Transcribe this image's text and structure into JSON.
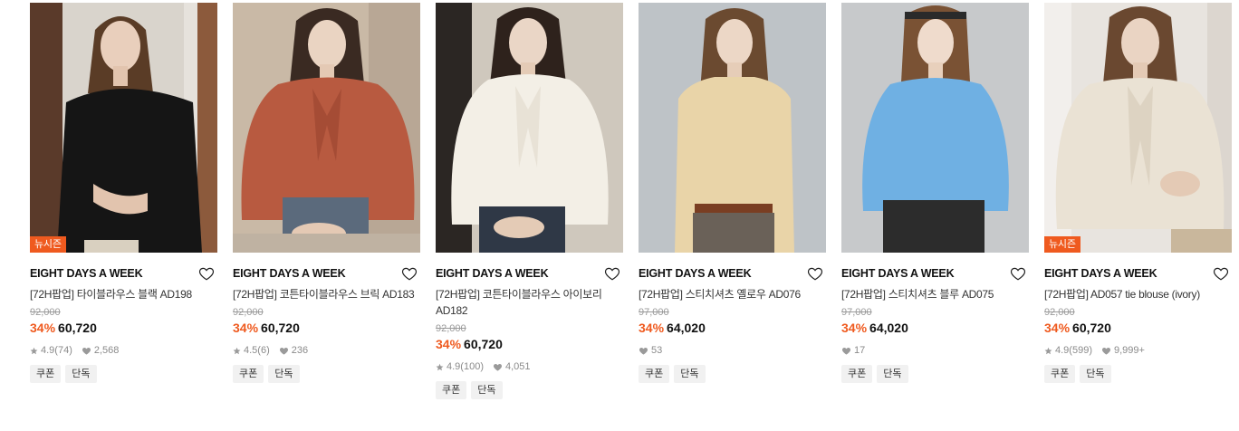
{
  "colors": {
    "accent": "#ef5a1f",
    "muted": "#9a9a9a",
    "tag_bg": "#f1f1f1"
  },
  "products": [
    {
      "badge": "뉴시즌",
      "brand": "EIGHT DAYS A WEEK",
      "name": "[72H팝업] 타이블라우스 블랙 AD198",
      "original_price": "92,000",
      "discount": "34%",
      "price": "60,720",
      "rating": "4.9",
      "reviews": "(74)",
      "likes": "2,568",
      "tags": [
        "쿠폰",
        "단독"
      ]
    },
    {
      "badge": "",
      "brand": "EIGHT DAYS A WEEK",
      "name": "[72H팝업] 코튼타이블라우스 브릭 AD183",
      "original_price": "92,000",
      "discount": "34%",
      "price": "60,720",
      "rating": "4.5",
      "reviews": "(6)",
      "likes": "236",
      "tags": [
        "쿠폰",
        "단독"
      ]
    },
    {
      "badge": "",
      "brand": "EIGHT DAYS A WEEK",
      "name": "[72H팝업] 코튼타이블라우스 아이보리 AD182",
      "original_price": "92,000",
      "discount": "34%",
      "price": "60,720",
      "rating": "4.9",
      "reviews": "(100)",
      "likes": "4,051",
      "tags": [
        "쿠폰",
        "단독"
      ]
    },
    {
      "badge": "",
      "brand": "EIGHT DAYS A WEEK",
      "name": "[72H팝업] 스티치셔츠 옐로우 AD076",
      "original_price": "97,000",
      "discount": "34%",
      "price": "64,020",
      "rating": "",
      "reviews": "",
      "likes": "53",
      "tags": [
        "쿠폰",
        "단독"
      ]
    },
    {
      "badge": "",
      "brand": "EIGHT DAYS A WEEK",
      "name": "[72H팝업] 스티치셔츠 블루 AD075",
      "original_price": "97,000",
      "discount": "34%",
      "price": "64,020",
      "rating": "",
      "reviews": "",
      "likes": "17",
      "tags": [
        "쿠폰",
        "단독"
      ]
    },
    {
      "badge": "뉴시즌",
      "brand": "EIGHT DAYS A WEEK",
      "name": "[72H팝업] AD057 tie blouse (ivory)",
      "original_price": "92,000",
      "discount": "34%",
      "price": "60,720",
      "rating": "4.9",
      "reviews": "(599)",
      "likes": "9,999+",
      "tags": [
        "쿠폰",
        "단독"
      ]
    }
  ],
  "icons": {
    "wishlist": "heart-outline-icon",
    "rating": "star-icon",
    "likes": "heart-filled-icon"
  }
}
